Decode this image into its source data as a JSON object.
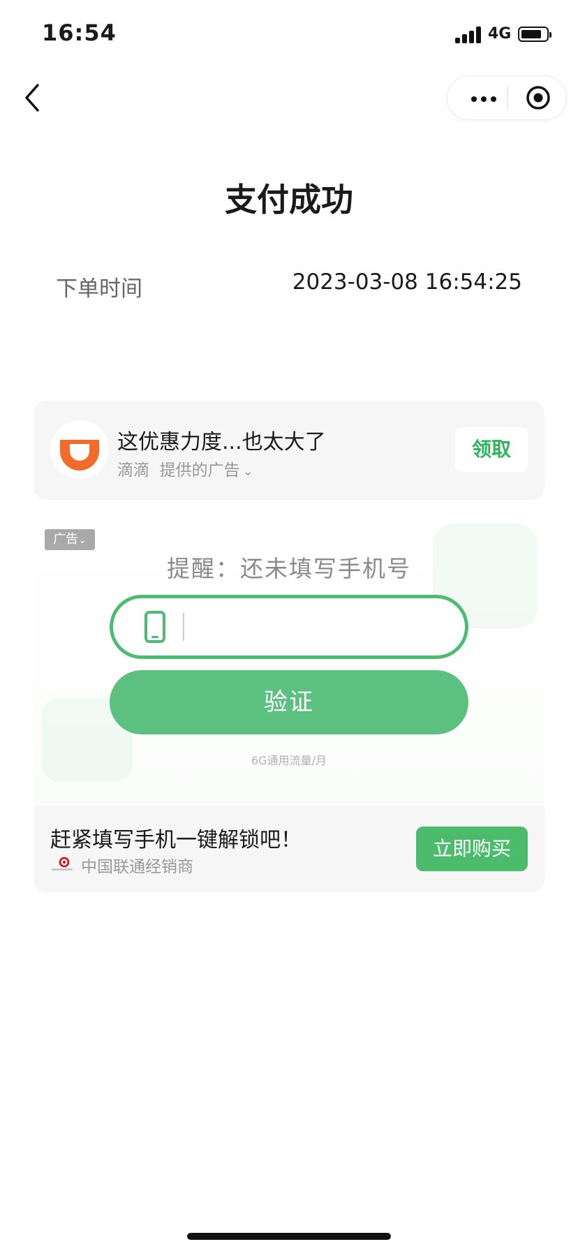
{
  "status_bar": {
    "time": "16:54",
    "network": "4G"
  },
  "nav": {
    "back_icon": "chevron-left-icon",
    "more_icon": "more-dots-icon",
    "target_icon": "target-icon"
  },
  "page": {
    "title": "支付成功"
  },
  "order": {
    "label": "下单时间",
    "value": "2023-03-08 16:54:25"
  },
  "ad1": {
    "title": "这优惠力度...也太大了",
    "sponsor": "滴滴",
    "provided": "提供的广告",
    "button": "领取",
    "icon": "didi-logo"
  },
  "banner": {
    "ad_badge": "广告",
    "reminder": "提醒：还未填写手机号",
    "phone_icon": "phone-icon",
    "verify_button": "验证",
    "note": "6G通用流量/月"
  },
  "ad2": {
    "title": "赶紧填写手机一键解锁吧！",
    "sponsor": "中国联通经销商",
    "button": "立即购买",
    "icon": "unicom-logo"
  },
  "colors": {
    "brand_green": "#4cbc6c",
    "claim_green": "#2bb45a",
    "didi_orange": "#f26b2a"
  }
}
